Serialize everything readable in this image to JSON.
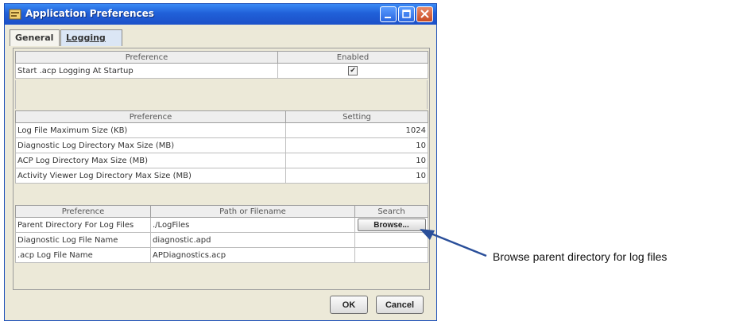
{
  "window": {
    "title": "Application Preferences"
  },
  "tabs": {
    "general": "General",
    "logging": "Logging"
  },
  "table1": {
    "headers": [
      "Preference",
      "Enabled"
    ],
    "rows": [
      {
        "name": "Start .acp Logging At Startup",
        "enabled": true
      }
    ]
  },
  "table2": {
    "headers": [
      "Preference",
      "Setting"
    ],
    "rows": [
      {
        "name": "Log File Maximum Size (KB)",
        "value": "1024"
      },
      {
        "name": "Diagnostic Log Directory Max Size (MB)",
        "value": "10"
      },
      {
        "name": "ACP Log Directory Max Size (MB)",
        "value": "10"
      },
      {
        "name": "Activity Viewer Log Directory Max Size (MB)",
        "value": "10"
      }
    ]
  },
  "table3": {
    "headers": [
      "Preference",
      "Path or Filename",
      "Search"
    ],
    "rows": [
      {
        "name": "Parent Directory For Log Files",
        "path": "./LogFiles",
        "search": "Browse..."
      },
      {
        "name": "Diagnostic Log File Name",
        "path": "diagnostic.apd",
        "search": ""
      },
      {
        "name": ".acp Log File Name",
        "path": "APDiagnostics.acp",
        "search": ""
      }
    ]
  },
  "buttons": {
    "ok": "OK",
    "cancel": "Cancel"
  },
  "annotation": {
    "text": "Browse parent directory for log files"
  },
  "colors": {
    "titlebar": "#2060d8",
    "arrow": "#2a4f9a"
  }
}
